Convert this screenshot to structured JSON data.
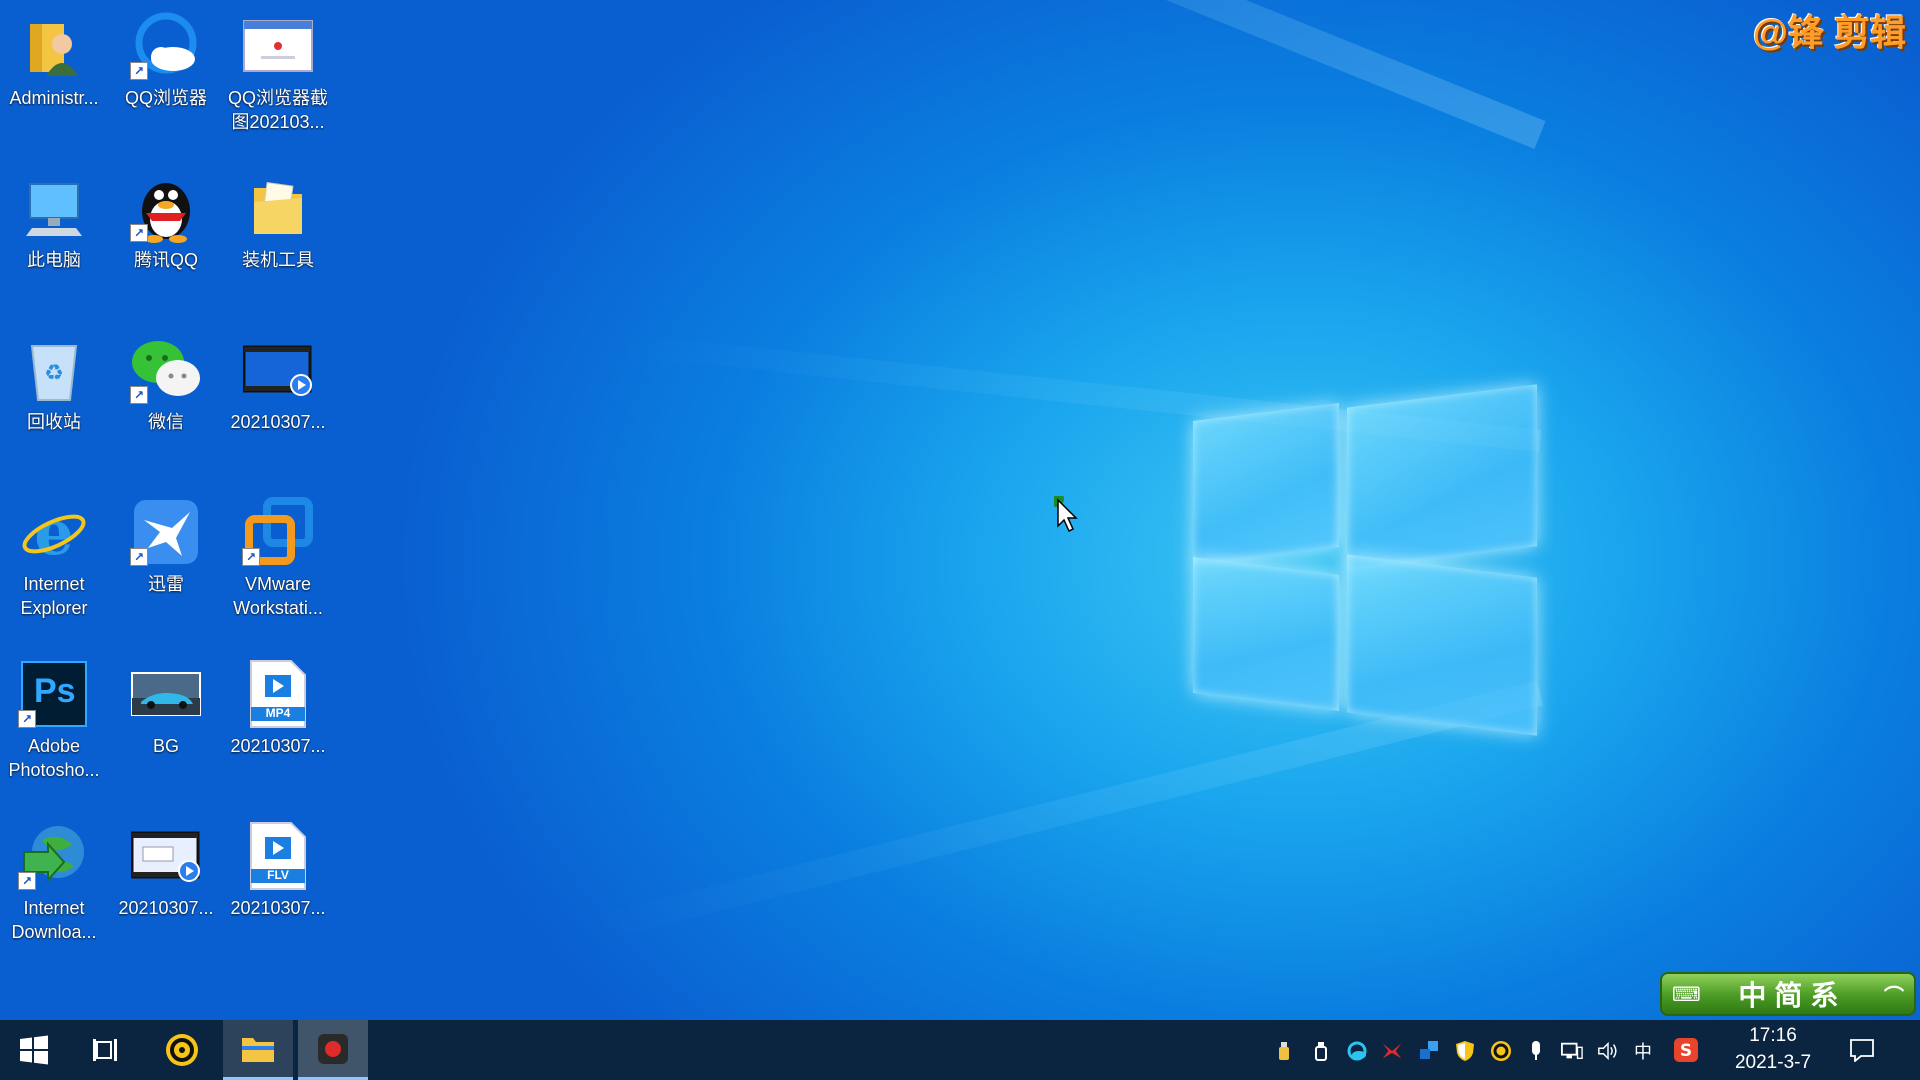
{
  "watermark": "@锋 剪辑",
  "desktop": {
    "icons": [
      {
        "label": "Administr...",
        "kind": "user-folder-icon"
      },
      {
        "label": "QQ浏览器",
        "kind": "qq-browser-icon"
      },
      {
        "label": "QQ浏览器截图202103...",
        "kind": "screenshot-file-icon"
      },
      {
        "label": "此电脑",
        "kind": "this-pc-icon"
      },
      {
        "label": "腾讯QQ",
        "kind": "qq-penguin-icon"
      },
      {
        "label": "装机工具",
        "kind": "folder-icon"
      },
      {
        "label": "回收站",
        "kind": "recycle-bin-icon"
      },
      {
        "label": "微信",
        "kind": "wechat-icon"
      },
      {
        "label": "20210307...",
        "kind": "video-project-icon"
      },
      {
        "label": "Internet Explorer",
        "kind": "internet-explorer-icon"
      },
      {
        "label": "迅雷",
        "kind": "thunder-icon"
      },
      {
        "label": "VMware Workstati...",
        "kind": "vmware-icon"
      },
      {
        "label": "Adobe Photosho...",
        "kind": "photoshop-icon"
      },
      {
        "label": "BG",
        "kind": "image-file-icon"
      },
      {
        "label": "20210307...",
        "kind": "mp4-file-icon"
      },
      {
        "label": "Internet Downloa...",
        "kind": "internet-download-manager-icon"
      },
      {
        "label": "20210307...",
        "kind": "video-project-icon"
      },
      {
        "label": "20210307...",
        "kind": "flv-file-icon"
      }
    ],
    "file_badges": {
      "mp4": "MP4",
      "flv": "FLV",
      "ps": "Ps"
    }
  },
  "ime_bar": {
    "text": "中简系"
  },
  "taskbar": {
    "items": [
      "start-icon",
      "task-view-icon",
      "qq-browser-taskbar-icon",
      "file-explorer-icon",
      "screen-recorder-icon"
    ],
    "tray": [
      "usb-icon",
      "usb-drive-icon",
      "qq-browser-tray-icon",
      "app-tray-icon",
      "network-tool-icon",
      "security-shield-icon",
      "browser-tray-icon",
      "microphone-icon",
      "network-icon",
      "volume-icon"
    ],
    "ime_indicator": "中",
    "clock_time": "17:16",
    "clock_date": "2021-3-7"
  },
  "colors": {
    "taskbar": "#0b2440",
    "accent": "#1aa6ee"
  }
}
